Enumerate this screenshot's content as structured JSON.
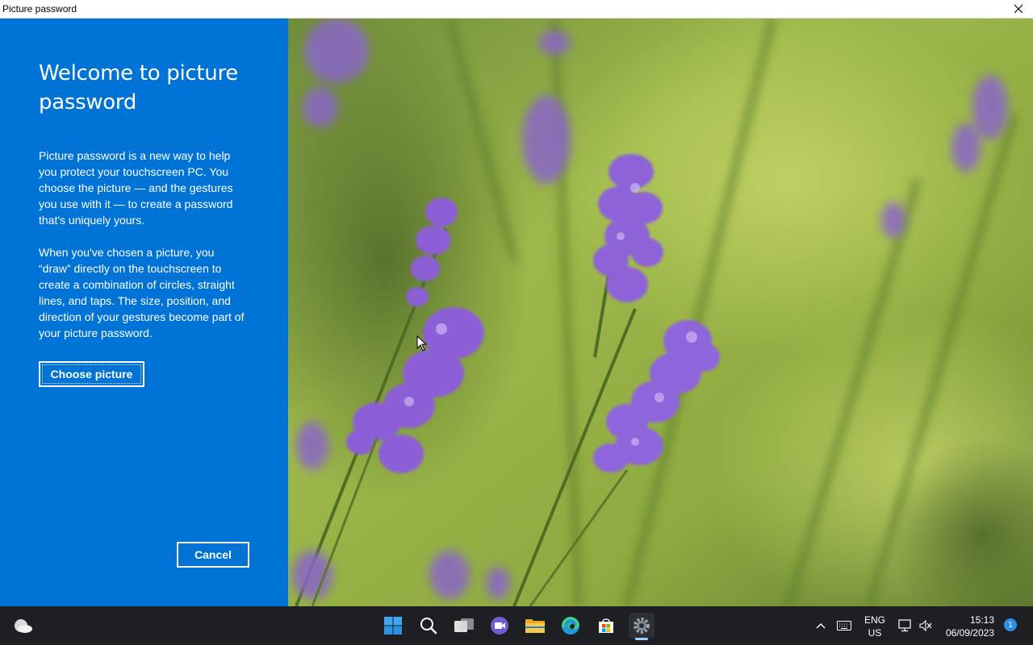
{
  "window": {
    "title": "Picture password"
  },
  "panel": {
    "heading": "Welcome to picture password",
    "paragraph_1": "Picture password is a new way to help you protect your touchscreen PC. You choose the picture — and the gestures you use with it — to create a password that's uniquely yours.",
    "paragraph_2": "When you've chosen a picture, you “draw” directly on the touchscreen to create a combination of circles, straight lines, and taps. The size, position, and direction of your gestures become part of your picture password.",
    "choose_label": "Choose picture",
    "cancel_label": "Cancel",
    "background_color": "#0073d6"
  },
  "picture": {
    "subject": "lavender-flowers"
  },
  "taskbar": {
    "icons": [
      "weather-icon",
      "start-icon",
      "search-icon",
      "task-view-icon",
      "chat-icon",
      "file-explorer-icon",
      "edge-icon",
      "store-icon",
      "settings-icon"
    ],
    "language_line1": "ENG",
    "language_line2": "US",
    "time": "15:13",
    "date": "06/09/2023",
    "notification_count": "1"
  }
}
